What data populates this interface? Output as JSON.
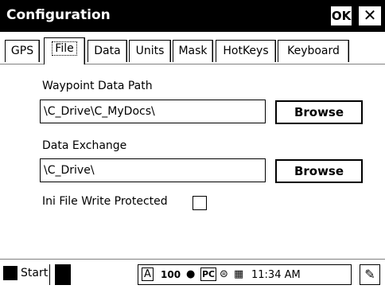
{
  "window": {
    "title": "Configuration",
    "ok_label": "OK",
    "close_label": "✕"
  },
  "tabs": [
    {
      "label": "GPS"
    },
    {
      "label": "File"
    },
    {
      "label": "Data"
    },
    {
      "label": "Units"
    },
    {
      "label": "Mask"
    },
    {
      "label": "HotKeys"
    },
    {
      "label": "Keyboard"
    }
  ],
  "active_tab": "File",
  "form": {
    "waypoint_label": "Waypoint Data Path",
    "waypoint_value": "\\C_Drive\\C_MyDocs\\",
    "exchange_label": "Data Exchange",
    "exchange_value": "\\C_Drive\\",
    "browse_label": "Browse",
    "ini_label": "Ini File Write Protected",
    "ini_checked": false
  },
  "taskbar": {
    "start_label": "Start",
    "tray_a": "A",
    "tray_battery": "100",
    "tray_pc": "PC",
    "clock": "11:34 AM"
  }
}
